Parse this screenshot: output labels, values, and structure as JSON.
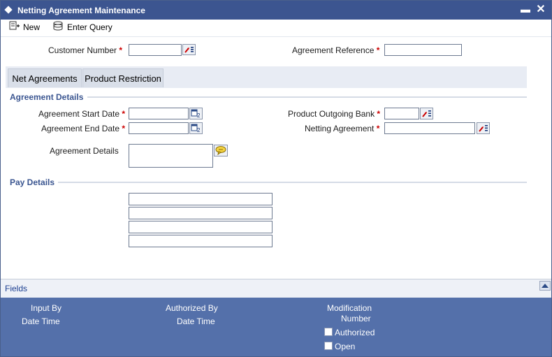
{
  "window": {
    "title": "Netting Agreement Maintenance"
  },
  "toolbar": {
    "new_label": "New",
    "enter_query_label": "Enter Query"
  },
  "header_fields": {
    "customer_number_label": "Customer Number",
    "agreement_reference_label": "Agreement Reference"
  },
  "tabs": [
    {
      "label": "Net Agreements"
    },
    {
      "label": "Product Restriction"
    }
  ],
  "agreement_details": {
    "section_title": "Agreement Details",
    "start_date_label": "Agreement Start Date",
    "end_date_label": "Agreement End Date",
    "details_label": "Agreement Details",
    "product_outgoing_bank_label": "Product Outgoing Bank",
    "netting_agreement_label": "Netting Agreement"
  },
  "pay_details": {
    "section_title": "Pay Details"
  },
  "footer": {
    "fields_label": "Fields"
  },
  "audit": {
    "input_by": "Input By",
    "date_time_1": "Date Time",
    "authorized_by": "Authorized By",
    "date_time_2": "Date Time",
    "modification": "Modification",
    "number": "Number",
    "authorized": "Authorized",
    "open": "Open"
  },
  "required_marker": "*",
  "icons": {
    "minimize": "minimize-icon",
    "close": "close-icon",
    "new": "new-document-icon",
    "enter_query": "query-icon",
    "lov": "list-of-values-icon",
    "calendar": "calendar-icon",
    "edit": "speech-bubble-icon",
    "scroll_up": "triangle-up-icon"
  },
  "colors": {
    "title_bar": "#3c5590",
    "audit_panel": "#5470aa",
    "section_title": "#3a5590",
    "required": "#cc0000"
  }
}
